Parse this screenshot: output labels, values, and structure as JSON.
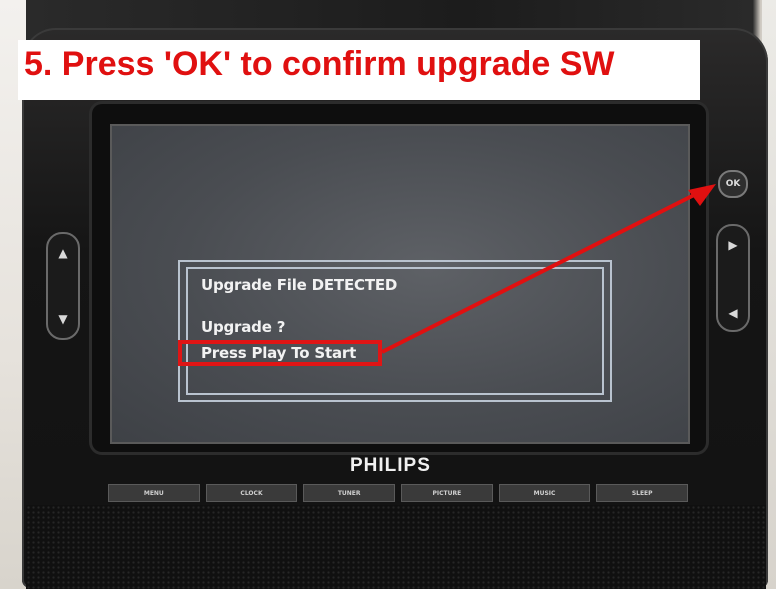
{
  "caption": {
    "text": "5. Press 'OK' to confirm upgrade SW"
  },
  "device": {
    "brand": "PHILIPS",
    "ok_button": "OK",
    "left_up_glyph": "▲",
    "left_down_glyph": "▼",
    "right_forward_glyph": "▶",
    "right_back_glyph": "◀"
  },
  "screen_dialog": {
    "line1": "Upgrade File DETECTED",
    "line2": "Upgrade ?",
    "line3": "Press Play To Start"
  },
  "bottom_buttons": [
    "MENU",
    "CLOCK",
    "TUNER",
    "PICTURE",
    "MUSIC",
    "SLEEP"
  ],
  "colors": {
    "annotation_red": "#e01010",
    "screen_bg": "#4a4d52",
    "dialog_border": "#b9c3cf"
  }
}
